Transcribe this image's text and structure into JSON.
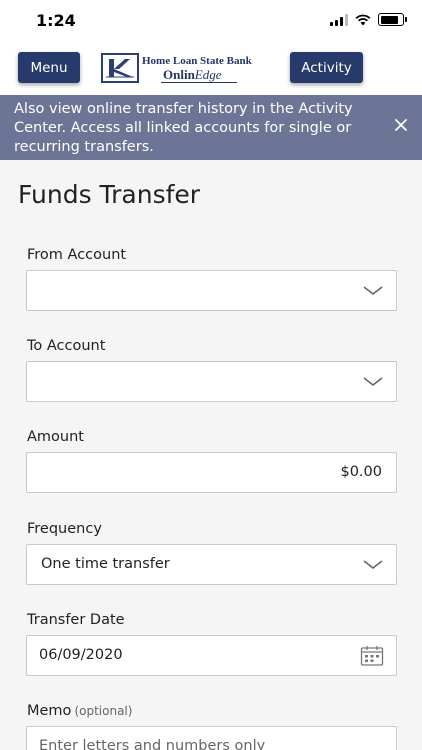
{
  "status_bar": {
    "time": "1:24",
    "battery_level": 0.85
  },
  "header": {
    "menu_label": "Menu",
    "activity_label": "Activity",
    "logo": {
      "line1": "Home Loan State Bank",
      "line2_bold": "Onlin",
      "line2_italic": "Edge"
    }
  },
  "banner": {
    "text": "Also view online transfer history in the Activity Center. Access all linked accounts for single or recurring transfers."
  },
  "page": {
    "title": "Funds Transfer"
  },
  "form": {
    "from_account": {
      "label": "From Account",
      "value": ""
    },
    "to_account": {
      "label": "To Account",
      "value": ""
    },
    "amount": {
      "label": "Amount",
      "value": "$0.00"
    },
    "frequency": {
      "label": "Frequency",
      "value": "One time transfer"
    },
    "transfer_date": {
      "label": "Transfer Date",
      "value": "06/09/2020"
    },
    "memo": {
      "label": "Memo",
      "optional": "(optional)",
      "placeholder": "Enter letters and numbers only"
    }
  },
  "colors": {
    "brand_navy": "#263a6b",
    "banner_bg": "#6d7596",
    "page_bg": "#f5f5f5"
  }
}
